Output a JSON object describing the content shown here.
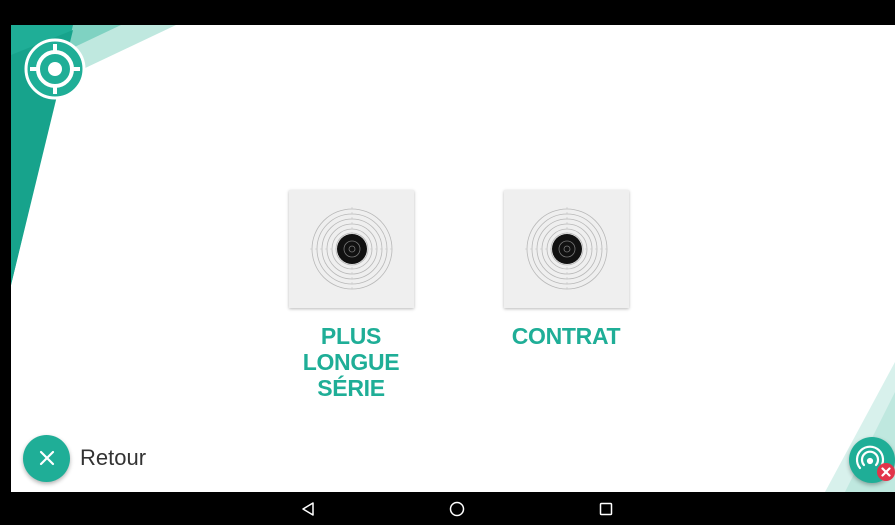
{
  "colors": {
    "accent": "#1fae97",
    "accent_light": "#7fd2c2",
    "danger": "#e2344a",
    "card_bg": "#efefef"
  },
  "header": {
    "logo_icon": "target-logo-icon"
  },
  "modes": [
    {
      "label": "PLUS LONGUE SÉRIE",
      "icon": "shooting-target-icon"
    },
    {
      "label": "CONTRAT",
      "icon": "shooting-target-icon"
    }
  ],
  "footer": {
    "back_label": "Retour",
    "back_icon": "close-icon",
    "connect_icon": "wireless-disconnected-icon"
  },
  "system_nav": {
    "back_icon": "nav-back-icon",
    "home_icon": "nav-home-icon",
    "recents_icon": "nav-recents-icon"
  }
}
